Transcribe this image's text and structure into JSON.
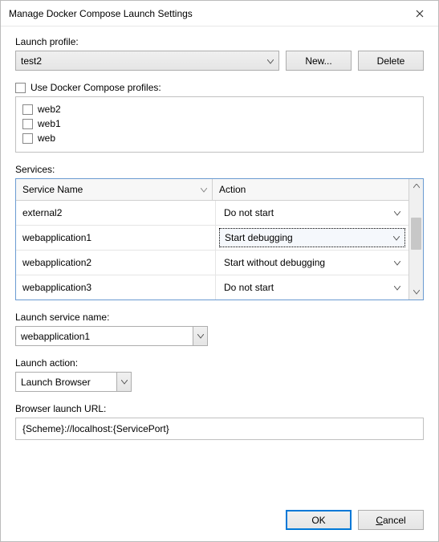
{
  "window": {
    "title": "Manage Docker Compose Launch Settings"
  },
  "launchProfile": {
    "label": "Launch profile:",
    "selected": "test2",
    "newButton": "New...",
    "deleteButton": "Delete"
  },
  "composeProfiles": {
    "checkboxLabel": "Use Docker Compose profiles:",
    "checked": false,
    "items": [
      {
        "name": "web2",
        "checked": false
      },
      {
        "name": "web1",
        "checked": false
      },
      {
        "name": "web",
        "checked": false
      }
    ]
  },
  "services": {
    "label": "Services:",
    "columns": {
      "name": "Service Name",
      "action": "Action"
    },
    "rows": [
      {
        "name": "external2",
        "action": "Do not start",
        "selected": false
      },
      {
        "name": "webapplication1",
        "action": "Start debugging",
        "selected": true
      },
      {
        "name": "webapplication2",
        "action": "Start without debugging",
        "selected": false
      },
      {
        "name": "webapplication3",
        "action": "Do not start",
        "selected": false
      }
    ]
  },
  "launchServiceName": {
    "label": "Launch service name:",
    "value": "webapplication1"
  },
  "launchAction": {
    "label": "Launch action:",
    "value": "Launch Browser"
  },
  "browserUrl": {
    "label": "Browser launch URL:",
    "value": "{Scheme}://localhost:{ServicePort}"
  },
  "footer": {
    "ok": "OK",
    "cancel": "Cancel"
  }
}
